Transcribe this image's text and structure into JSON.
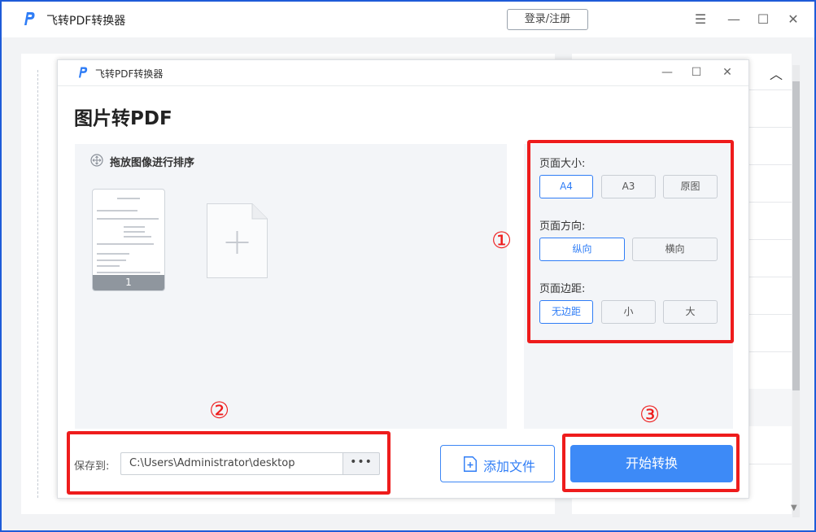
{
  "app": {
    "title": "飞转PDF转换器",
    "login_label": "登录/注册",
    "brand_color": "#2f7df6"
  },
  "icons": {
    "logo": "pdf-p-logo-icon",
    "menu": "menu-icon",
    "minimize": "minimize-icon",
    "maximize": "maximize-icon",
    "close": "close-icon",
    "sort": "move-drag-icon",
    "add_page": "add-page-placeholder-icon",
    "add_file": "add-file-icon",
    "collapse": "chevron-up-icon",
    "ellipsis": "more-icon"
  },
  "dialog": {
    "title": "飞转PDF转换器",
    "page_title": "图片转PDF",
    "sort_label": "拖放图像进行排序",
    "thumbnails": [
      {
        "page_number": "1"
      }
    ],
    "options": {
      "page_size": {
        "label": "页面大小:",
        "options": [
          "A4",
          "A3",
          "原图"
        ],
        "selected": "A4"
      },
      "orientation": {
        "label": "页面方向:",
        "options": [
          "纵向",
          "横向"
        ],
        "selected": "纵向"
      },
      "margin": {
        "label": "页面边距:",
        "options": [
          "无边距",
          "小",
          "大"
        ],
        "selected": "无边距"
      }
    },
    "save": {
      "label": "保存到:",
      "path": "C:\\Users\\Administrator\\desktop",
      "browse_label": "•••"
    },
    "add_file_label": "添加文件",
    "start_label": "开始转换"
  },
  "annotations": {
    "one": "①",
    "two": "②",
    "three": "③",
    "color": "#ee1c1c"
  }
}
